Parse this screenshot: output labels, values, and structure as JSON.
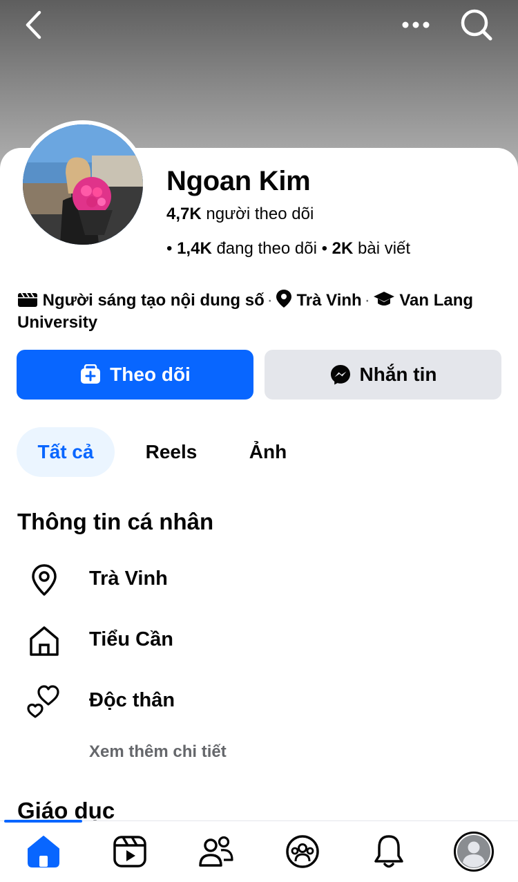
{
  "profile": {
    "name": "Ngoan Kim",
    "followers_count": "4,7K",
    "followers_label": "người theo dõi",
    "following_count": "1,4K",
    "following_label": "đang theo dõi",
    "posts_count": "2K",
    "posts_label": "bài viết"
  },
  "bio": {
    "category": "Người sáng tạo nội dung số",
    "location": "Trà Vinh",
    "school": "Van Lang University"
  },
  "actions": {
    "follow_label": "Theo dõi",
    "message_label": "Nhắn tin"
  },
  "tabs": [
    {
      "label": "Tất cả",
      "active": true
    },
    {
      "label": "Reels",
      "active": false
    },
    {
      "label": "Ảnh",
      "active": false
    }
  ],
  "personal_info": {
    "title": "Thông tin cá nhân",
    "items": [
      {
        "icon": "location-pin-icon",
        "text": "Trà Vinh"
      },
      {
        "icon": "home-icon",
        "text": "Tiểu Cần"
      },
      {
        "icon": "hearts-icon",
        "text": "Độc thân"
      }
    ],
    "see_more": "Xem thêm chi tiết"
  },
  "education": {
    "title": "Giáo dục"
  },
  "bottom_nav": [
    {
      "icon": "home-icon",
      "active": true
    },
    {
      "icon": "video-icon",
      "active": false
    },
    {
      "icon": "friends-icon",
      "active": false
    },
    {
      "icon": "groups-icon",
      "active": false
    },
    {
      "icon": "bell-icon",
      "active": false
    },
    {
      "icon": "profile-avatar-icon",
      "active": false
    }
  ],
  "colors": {
    "accent": "#0866ff",
    "tab_active_bg": "#ebf5ff",
    "secondary_button_bg": "#e4e6eb",
    "muted_text": "#65676b"
  }
}
